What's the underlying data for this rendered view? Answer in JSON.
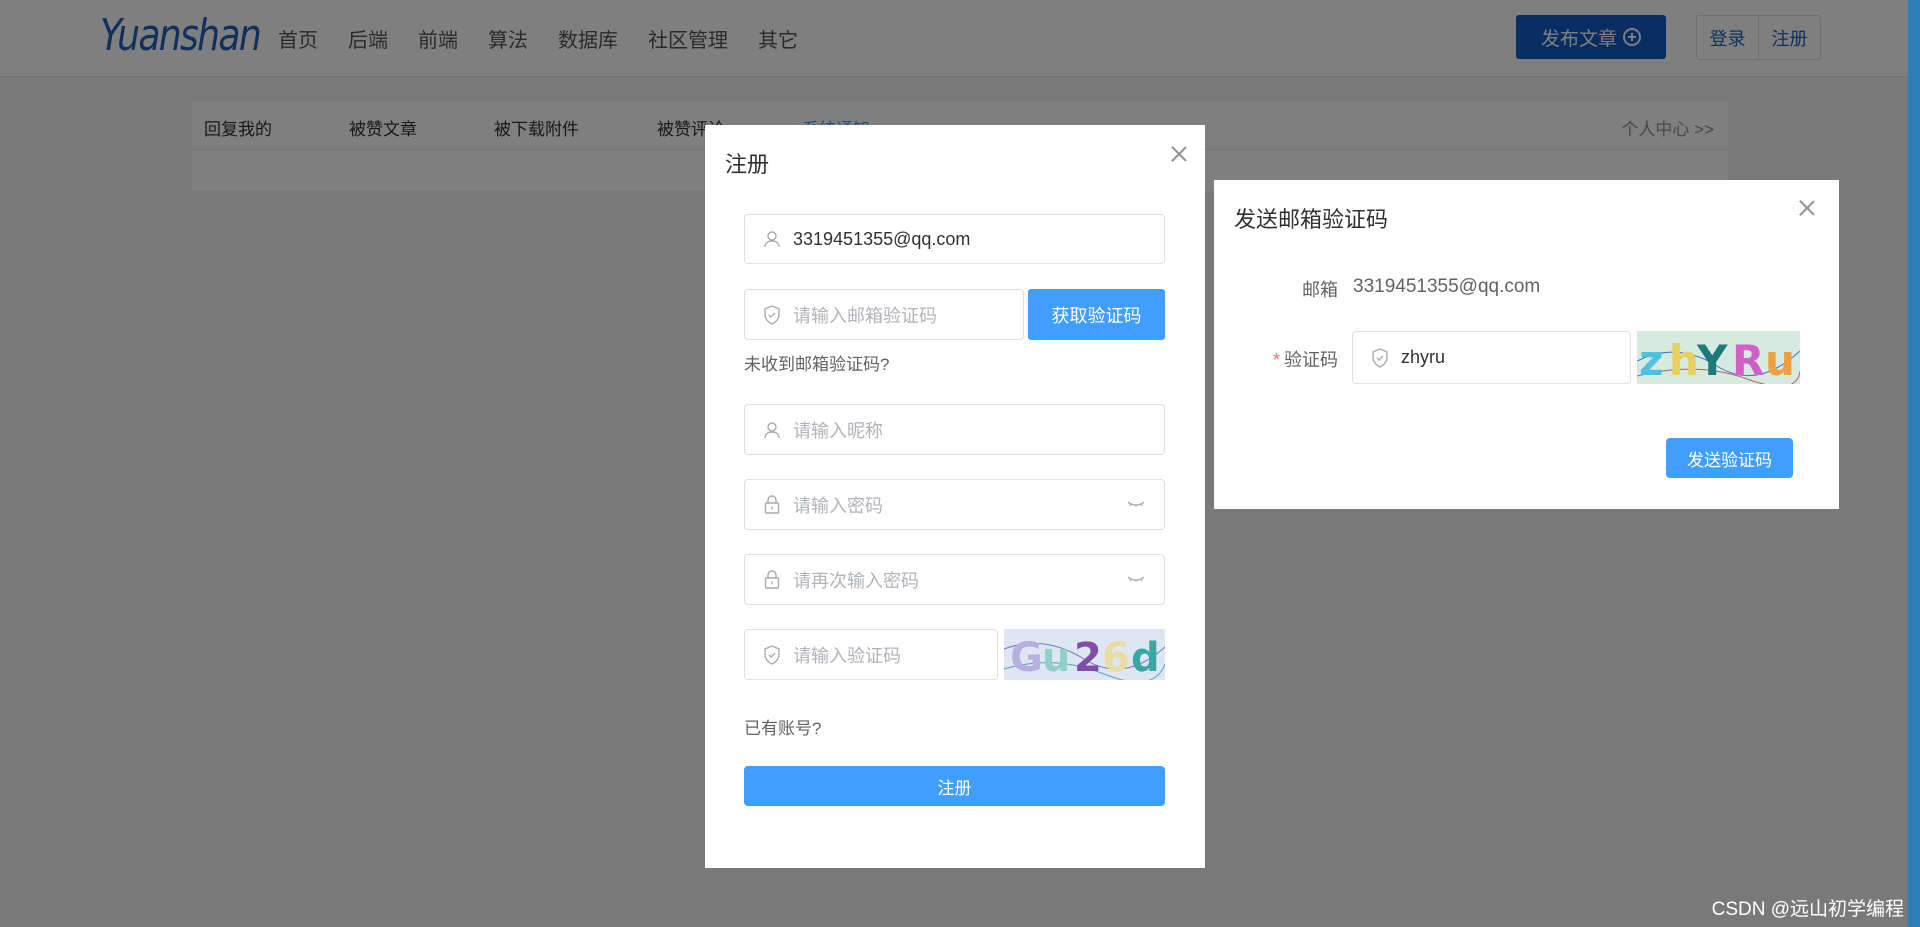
{
  "header": {
    "logo": "Yuanshan",
    "nav": [
      "首页",
      "后端",
      "前端",
      "算法",
      "数据库",
      "社区管理",
      "其它"
    ],
    "publish_label": "发布文章",
    "login_label": "登录",
    "register_label": "注册"
  },
  "notice": {
    "tabs": [
      "回复我的",
      "被赞文章",
      "被下载附件",
      "被赞评论",
      "系统通知"
    ],
    "active_tab": "系统通知",
    "personal_center": "个人中心 >>"
  },
  "register_dialog": {
    "title": "注册",
    "email_value": "3319451355@qq.com",
    "email_code_placeholder": "请输入邮箱验证码",
    "get_code_label": "获取验证码",
    "not_received": "未收到邮箱验证码?",
    "nickname_placeholder": "请输入昵称",
    "password_placeholder": "请输入密码",
    "password_confirm_placeholder": "请再次输入密码",
    "captcha_placeholder": "请输入验证码",
    "captcha_image_text": "Gu26d",
    "have_account": "已有账号?",
    "submit_label": "注册"
  },
  "email_dialog": {
    "title": "发送邮箱验证码",
    "email_label": "邮箱",
    "email_value": "3319451355@qq.com",
    "code_label": "验证码",
    "code_value": "zhyru",
    "captcha_image_text": "zhYRu",
    "send_label": "发送验证码"
  },
  "watermark": "CSDN @远山初学编程",
  "colors": {
    "primary": "#409eff",
    "brand_dark": "#0f5bc5",
    "logo": "#1f5fb8",
    "required": "#f56c6c"
  },
  "icons": [
    "user-icon",
    "shield-icon",
    "lock-icon",
    "eye-closed-icon",
    "close-icon",
    "plus-circle-icon"
  ]
}
